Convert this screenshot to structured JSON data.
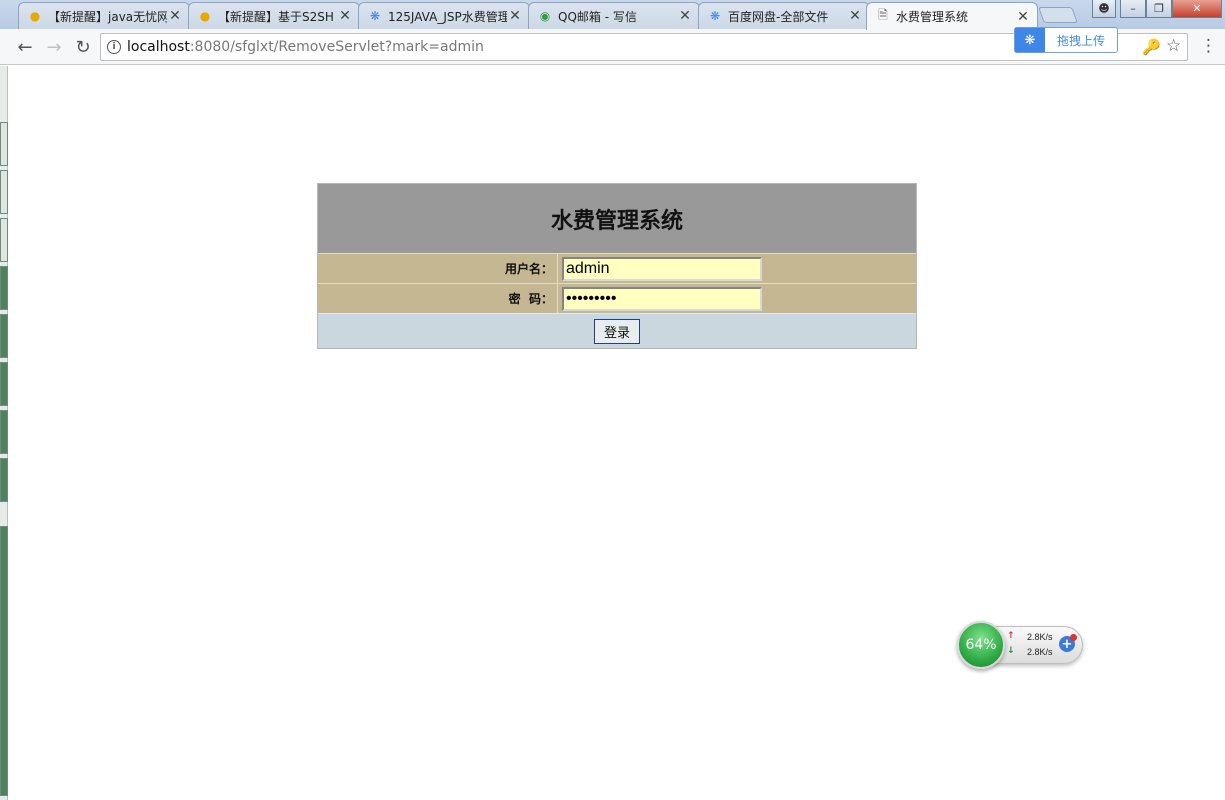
{
  "browser": {
    "tabs": [
      {
        "title": "【新提醒】java无忧网",
        "icon": "chat-bubble-icon"
      },
      {
        "title": "【新提醒】基于S2SH",
        "icon": "chat-bubble-icon"
      },
      {
        "title": "125JAVA_JSP水费管理",
        "icon": "baidu-cloud-icon"
      },
      {
        "title": "QQ邮箱 - 写信",
        "icon": "chrome-icon"
      },
      {
        "title": "百度网盘-全部文件",
        "icon": "baidu-cloud-icon"
      },
      {
        "title": "水费管理系统",
        "icon": "page-icon"
      }
    ],
    "active_tab_index": 5,
    "address": {
      "host": "localhost",
      "path": ":8080/sfglxt/RemoveServlet?mark=admin"
    },
    "upload_label": "拖拽上传"
  },
  "login": {
    "title": "水费管理系统",
    "username_label": "用户名：",
    "username_value": "admin",
    "password_label": "密  码：",
    "password_value": "123456789",
    "submit_label": "登录"
  },
  "netmon": {
    "usage": "64%",
    "up_rate": "2.8K/s",
    "down_rate": "2.8K/s"
  },
  "colors": {
    "header_bg": "#999999",
    "row_bg": "#c5b791",
    "footer_bg": "#cbd7de",
    "input_bg": "#ffffc0"
  }
}
